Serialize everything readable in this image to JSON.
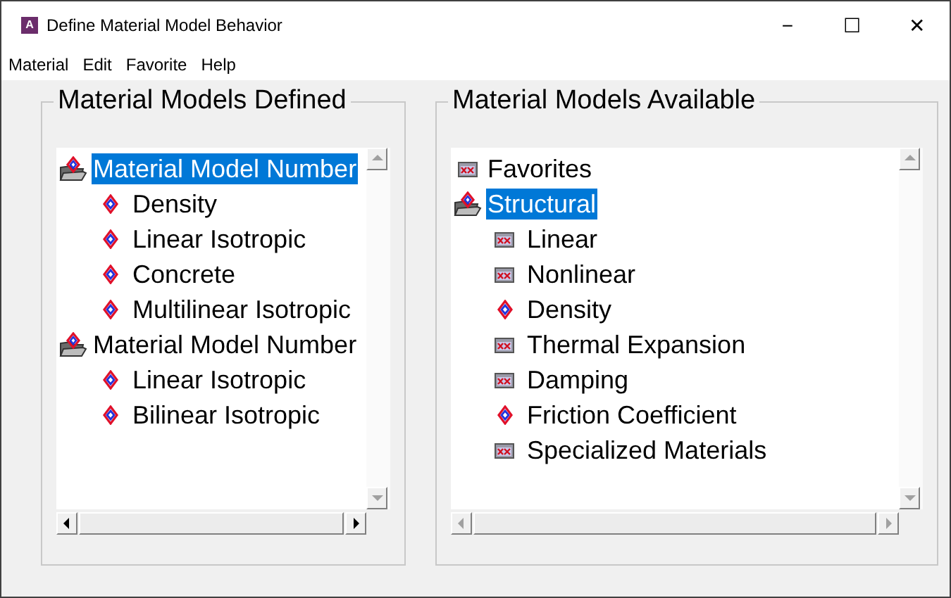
{
  "window": {
    "title": "Define Material Model Behavior",
    "app_icon_letter": "A"
  },
  "window_controls": [
    "−",
    "☐",
    "✕"
  ],
  "menu": [
    "Material",
    "Edit",
    "Favorite",
    "Help"
  ],
  "panels": [
    {
      "title": "Material Models Defined",
      "tree": [
        {
          "label": "Material Model Number",
          "kind": "folder",
          "expanded": true,
          "selected": true,
          "children": [
            {
              "label": "Density",
              "kind": "leaf",
              "selected": false
            },
            {
              "label": "Linear Isotropic",
              "kind": "leaf",
              "selected": false
            },
            {
              "label": "Concrete",
              "kind": "leaf",
              "selected": false
            },
            {
              "label": "Multilinear Isotropic",
              "kind": "leaf",
              "selected": false
            }
          ]
        },
        {
          "label": "Material Model Number",
          "kind": "folder",
          "expanded": true,
          "selected": false,
          "children": [
            {
              "label": "Linear Isotropic",
              "kind": "leaf",
              "selected": false
            },
            {
              "label": "Bilinear Isotropic",
              "kind": "leaf",
              "selected": false
            }
          ]
        }
      ]
    },
    {
      "title": "Material Models Available",
      "tree": [
        {
          "label": "Favorites",
          "kind": "folder",
          "expanded": false,
          "selected": false
        },
        {
          "label": "Structural",
          "kind": "folder",
          "expanded": true,
          "selected": true,
          "children": [
            {
              "label": "Linear",
              "kind": "folder",
              "expanded": false,
              "selected": false
            },
            {
              "label": "Nonlinear",
              "kind": "folder",
              "expanded": false,
              "selected": false
            },
            {
              "label": "Density",
              "kind": "leaf",
              "selected": false
            },
            {
              "label": "Thermal Expansion",
              "kind": "folder",
              "expanded": false,
              "selected": false
            },
            {
              "label": "Damping",
              "kind": "folder",
              "expanded": false,
              "selected": false
            },
            {
              "label": "Friction Coefficient",
              "kind": "leaf",
              "selected": false
            },
            {
              "label": "Specialized Materials",
              "kind": "folder",
              "expanded": false,
              "selected": false
            }
          ]
        }
      ]
    }
  ]
}
